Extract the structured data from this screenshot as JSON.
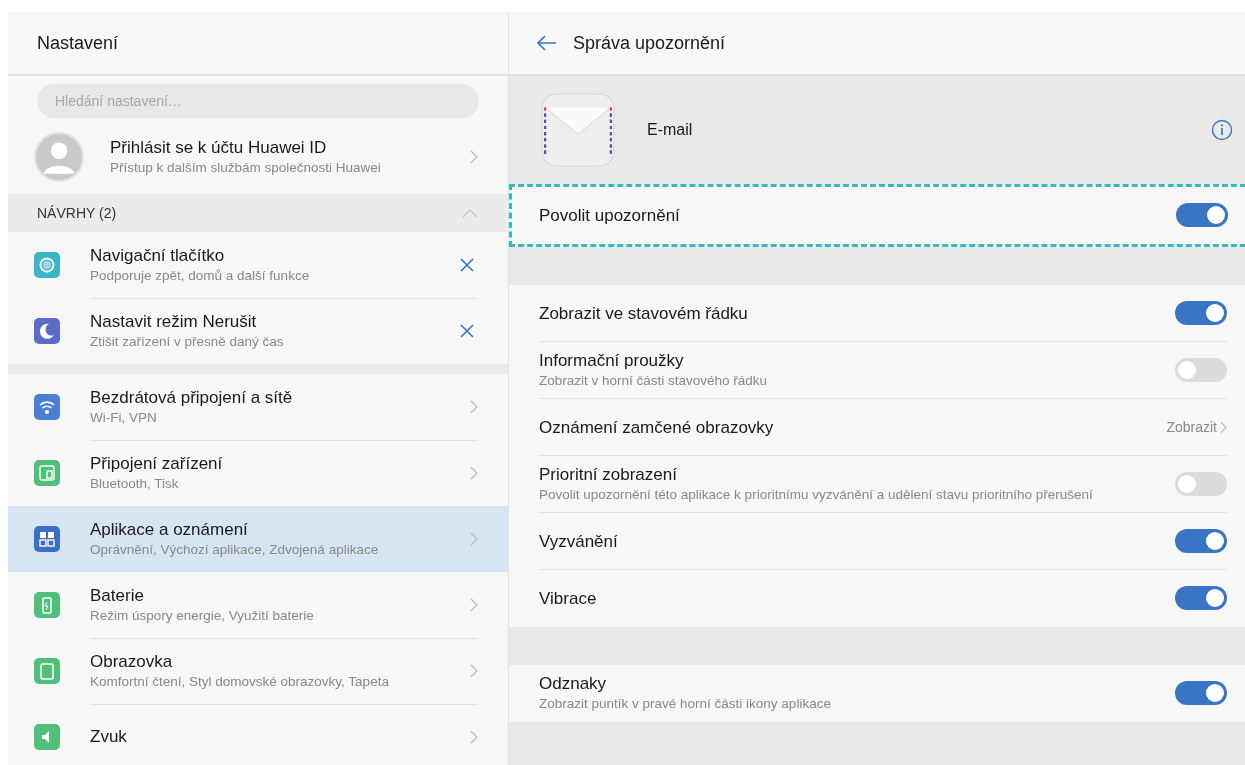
{
  "left": {
    "title": "Nastavení",
    "search": {
      "placeholder": "Hledání nastavení…"
    },
    "account": {
      "title": "Přihlásit se k účtu Huawei ID",
      "subtitle": "Přístup k dalším službám společnosti Huawei"
    },
    "suggestions": {
      "label": "NÁVRHY (2)",
      "expanded": true,
      "items": [
        {
          "kind": "navigation",
          "color": "#3bb5c8",
          "title": "Navigační tlačítko",
          "subtitle": "Podporuje zpět, domů a další funkce"
        },
        {
          "kind": "moon",
          "color": "#5b6bc8",
          "title": "Nastavit režim Nerušit",
          "subtitle": "Ztišit zařízení v přesně daný čas"
        }
      ]
    },
    "items": [
      {
        "kind": "wifi",
        "color": "#4a7fd4",
        "title": "Bezdrátová připojení a sítě",
        "subtitle": "Wi-Fi, VPN",
        "selected": false
      },
      {
        "kind": "devices",
        "color": "#4fbf7a",
        "title": "Připojení zařízení",
        "subtitle": "Bluetooth, Tisk",
        "selected": false
      },
      {
        "kind": "apps",
        "color": "#3d6fc4",
        "title": "Aplikace a oznámení",
        "subtitle": "Oprávnění, Výchozí aplikace, Zdvojená aplikace",
        "selected": true
      },
      {
        "kind": "battery",
        "color": "#4fbf7a",
        "title": "Baterie",
        "subtitle": "Režim úspory energie, Využití baterie",
        "selected": false
      },
      {
        "kind": "display",
        "color": "#4fbf7a",
        "title": "Obrazovka",
        "subtitle": "Komfortní čtení, Styl domovské obrazovky, Tapeta",
        "selected": false
      },
      {
        "kind": "sound",
        "color": "#4fbf7a",
        "title": "Zvuk",
        "selected": false
      }
    ]
  },
  "right": {
    "title": "Správa upozornění",
    "app": {
      "name": "E-mail"
    },
    "groups": [
      [
        {
          "kind": "toggle",
          "title": "Povolit upozornění",
          "on": true,
          "highlighted": true
        }
      ],
      [
        {
          "kind": "toggle",
          "title": "Zobrazit ve stavovém řádku",
          "on": true,
          "highlighted": false
        },
        {
          "kind": "toggle",
          "title": "Informační proužky",
          "subtitle": "Zobrazit v horní části stavového řádku",
          "on": false,
          "highlighted": false
        },
        {
          "kind": "link",
          "title": "Oznámení zamčené obrazovky",
          "value": "Zobrazit",
          "highlighted": false
        },
        {
          "kind": "toggle",
          "title": "Prioritní zobrazení",
          "subtitle": "Povolit upozornění této aplikace k prioritnímu vyzvánění a udělení stavu prioritního přerušení",
          "on": false,
          "highlighted": false
        },
        {
          "kind": "toggle",
          "title": "Vyzvánění",
          "on": true,
          "highlighted": false
        },
        {
          "kind": "toggle",
          "title": "Vibrace",
          "on": true,
          "highlighted": false
        }
      ],
      [
        {
          "kind": "toggle",
          "title": "Odznaky",
          "subtitle": "Zobrazit puntík v pravé horní části ikony aplikace",
          "on": true,
          "highlighted": false
        }
      ]
    ]
  }
}
